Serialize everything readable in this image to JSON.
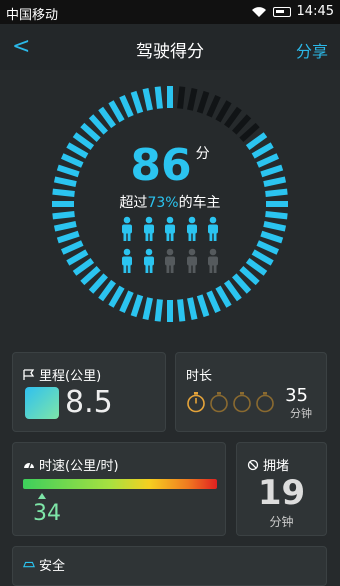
{
  "status": {
    "carrier": "中国移动",
    "time": "14:45"
  },
  "header": {
    "back": "<",
    "title": "驾驶得分",
    "share": "分享"
  },
  "score": {
    "value": "86",
    "unit": "分",
    "percentile": 0.73
  },
  "exceed": {
    "prefix": "超过",
    "pct": "73%",
    "suffix": "的车主"
  },
  "people": {
    "total": 10,
    "highlighted": 7
  },
  "cards": {
    "mileage": {
      "label": "里程(公里)",
      "value": "8.5"
    },
    "duration": {
      "label": "时长",
      "value": "35",
      "unit": "分钟",
      "timers": 4,
      "active": 1
    },
    "speed": {
      "label": "时速(公里/时)",
      "value": "34",
      "marker_fraction": 0.1
    },
    "jam": {
      "label": "拥堵",
      "value": "19",
      "unit": "分钟"
    },
    "safety": {
      "label": "安全"
    }
  },
  "colors": {
    "accent": "#2bc4f0",
    "dim": "#555a5d",
    "speed": "#7ee6a8",
    "timer": "#e6a43a"
  }
}
